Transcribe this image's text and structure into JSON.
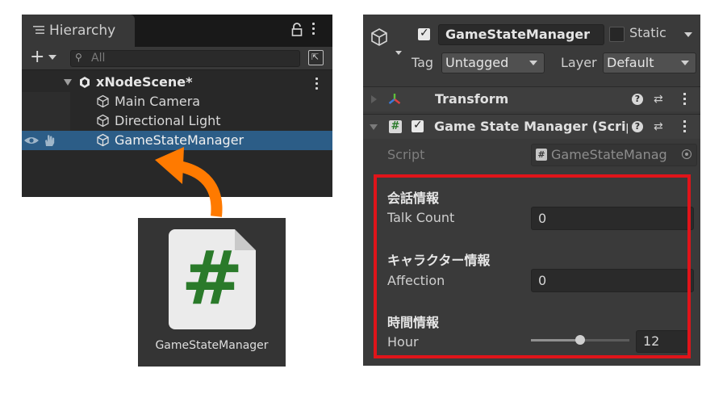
{
  "hierarchy": {
    "tab_label": "Hierarchy",
    "search_placeholder": "All",
    "scene_name": "xNodeScene*",
    "items": [
      {
        "label": "Main Camera"
      },
      {
        "label": "Directional Light"
      },
      {
        "label": "GameStateManager",
        "selected": true
      }
    ]
  },
  "asset": {
    "icon_symbol": "#",
    "name": "GameStateManager"
  },
  "inspector": {
    "object_name": "GameStateManager",
    "static_label": "Static",
    "tag_label": "Tag",
    "tag_value": "Untagged",
    "layer_label": "Layer",
    "layer_value": "Default",
    "components": [
      {
        "title": "Transform"
      },
      {
        "title": "Game State Manager (Scrip"
      }
    ],
    "script_label": "Script",
    "script_value": "GameStateManag",
    "sections": [
      {
        "header": "会話情報",
        "field_label": "Talk Count",
        "value": "0"
      },
      {
        "header": "キャラクター情報",
        "field_label": "Affection",
        "value": "0"
      },
      {
        "header": "時間情報",
        "field_label": "Hour",
        "value": "12",
        "slider_fraction": 0.5
      }
    ]
  },
  "colors": {
    "selection": "#2c5d87",
    "highlight_box": "#e0141a",
    "arrow": "#ff7a00",
    "script_hash": "#2a7a2a"
  }
}
